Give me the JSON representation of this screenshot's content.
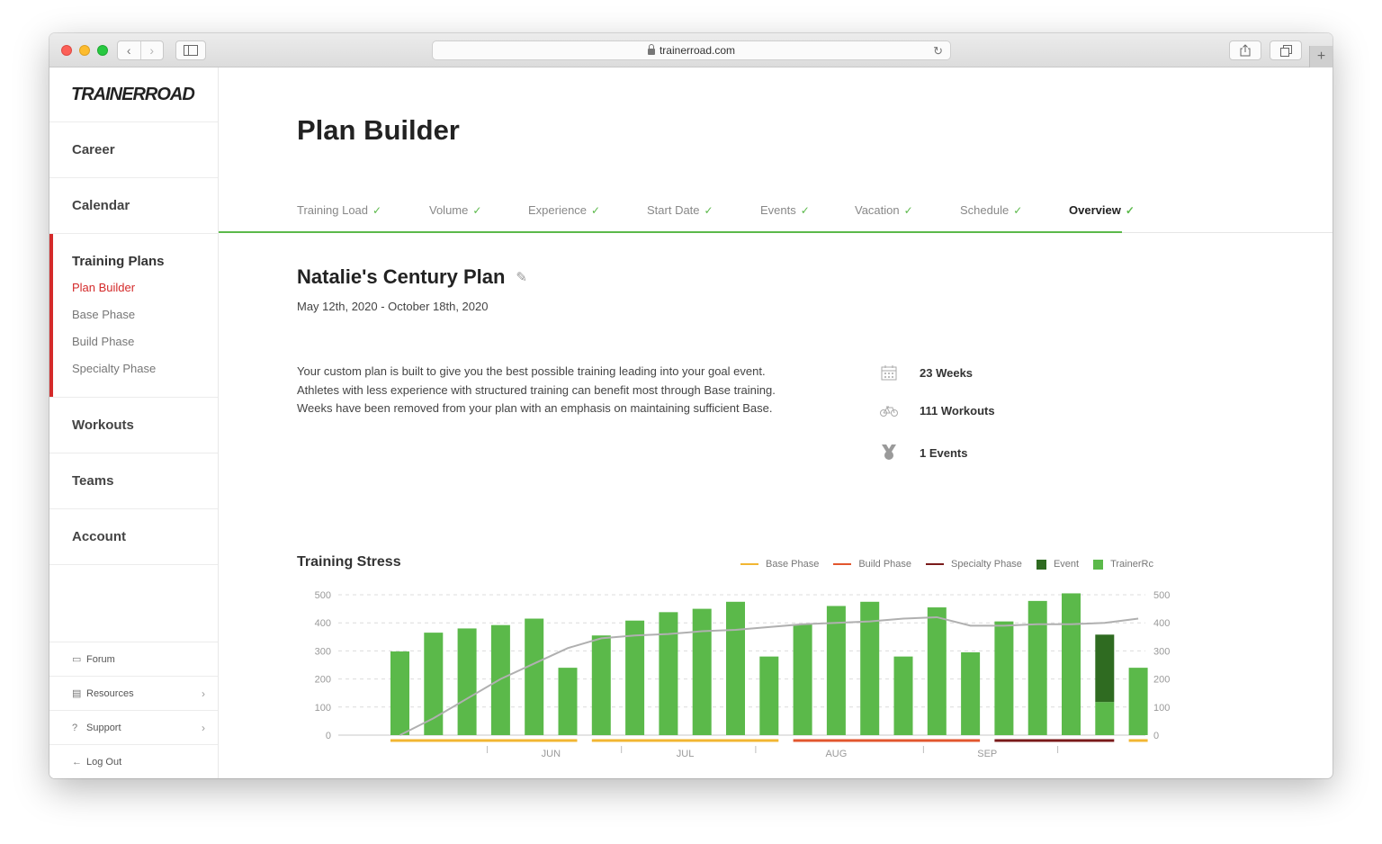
{
  "browser": {
    "url": "trainerroad.com",
    "icons": {
      "back": "chevron-left-icon",
      "forward": "chevron-right-icon",
      "sidebar": "sidebar-icon",
      "share": "share-icon",
      "tabs": "tabs-icon",
      "new_tab": "plus-icon",
      "reload": "reload-icon",
      "lock": "lock-icon"
    }
  },
  "sidebar": {
    "logo": "TRAINERROAD",
    "items": [
      {
        "label": "Career"
      },
      {
        "label": "Calendar"
      }
    ],
    "group": {
      "title": "Training Plans",
      "subitems": [
        {
          "label": "Plan Builder",
          "active": true
        },
        {
          "label": "Base Phase"
        },
        {
          "label": "Build Phase"
        },
        {
          "label": "Specialty Phase"
        }
      ]
    },
    "items2": [
      {
        "label": "Workouts"
      },
      {
        "label": "Teams"
      },
      {
        "label": "Account"
      }
    ],
    "bottom": [
      {
        "label": "Forum",
        "icon": "chat-icon"
      },
      {
        "label": "Resources",
        "icon": "book-icon",
        "chevron": true
      },
      {
        "label": "Support",
        "icon": "help-icon",
        "chevron": true
      },
      {
        "label": "Log Out",
        "icon": "arrow-left-icon"
      }
    ],
    "accent_color": "#d42a2a"
  },
  "page": {
    "title": "Plan Builder",
    "tabs": [
      {
        "label": "Training Load"
      },
      {
        "label": "Volume"
      },
      {
        "label": "Experience"
      },
      {
        "label": "Start Date"
      },
      {
        "label": "Events"
      },
      {
        "label": "Vacation"
      },
      {
        "label": "Schedule"
      },
      {
        "label": "Overview",
        "current": true
      }
    ],
    "check_glyph": "✓",
    "plan_name": "Natalie's Century Plan",
    "plan_dates": "May 12th, 2020 - October 18th, 2020",
    "description": [
      "Your custom plan is built to give you the best possible training leading into your goal event.",
      "Athletes with less experience with structured training can benefit most through Base training.",
      "Weeks have been removed from your plan with an emphasis on maintaining sufficient Base."
    ],
    "stats": [
      {
        "label": "23 Weeks",
        "icon": "calendar-icon"
      },
      {
        "label": "111 Workouts",
        "icon": "bike-icon"
      },
      {
        "label": "1 Events",
        "icon": "medal-icon"
      }
    ]
  },
  "chart_data": {
    "type": "bar",
    "title": "Training Stress",
    "legend": [
      {
        "label": "Base Phase",
        "color": "#f2b632",
        "kind": "line"
      },
      {
        "label": "Build Phase",
        "color": "#e2562e",
        "kind": "line"
      },
      {
        "label": "Specialty Phase",
        "color": "#7a1a1a",
        "kind": "line"
      },
      {
        "label": "Event",
        "color": "#2f6b21",
        "kind": "square"
      },
      {
        "label": "TrainerRc",
        "color": "#5bb94a",
        "kind": "square"
      }
    ],
    "ylim": [
      0,
      500
    ],
    "yticks_left": [
      "500",
      "400",
      "300",
      "200",
      "100",
      "0"
    ],
    "yticks_right": [
      "500",
      "400",
      "300",
      "200",
      "100",
      "0"
    ],
    "month_labels": [
      {
        "label": "JUN",
        "after_bar": 4.5
      },
      {
        "label": "JUL",
        "after_bar": 8.5
      },
      {
        "label": "AUG",
        "after_bar": 13
      },
      {
        "label": "SEP",
        "after_bar": 17.5
      }
    ],
    "month_separators_after_bar": [
      2.6,
      6.6,
      10.6,
      15.6,
      19.6
    ],
    "series": [
      {
        "name": "TrainerRc",
        "values": [
          298,
          365,
          380,
          392,
          415,
          240,
          355,
          408,
          438,
          450,
          475,
          280,
          395,
          460,
          475,
          280,
          455,
          295,
          405,
          478,
          505,
          118,
          240
        ]
      },
      {
        "name": "Event",
        "values": [
          0,
          0,
          0,
          0,
          0,
          0,
          0,
          0,
          0,
          0,
          0,
          0,
          0,
          0,
          0,
          0,
          0,
          0,
          0,
          0,
          0,
          240,
          0
        ]
      }
    ],
    "fitness_line": [
      0,
      60,
      130,
      200,
      255,
      310,
      345,
      355,
      360,
      370,
      375,
      385,
      395,
      400,
      405,
      415,
      420,
      390,
      390,
      395,
      395,
      400,
      415
    ],
    "phases": [
      {
        "label": "Base Phase",
        "start": 0,
        "end": 5,
        "color": "#f2b632"
      },
      {
        "label": "Base Phase",
        "start": 6,
        "end": 11,
        "color": "#f2b632"
      },
      {
        "label": "Build Phase",
        "start": 12,
        "end": 17,
        "color": "#e2562e"
      },
      {
        "label": "Specialty Phase",
        "start": 18,
        "end": 21,
        "color": "#7a1a1a"
      },
      {
        "label": "Base Phase",
        "start": 22,
        "end": 22,
        "color": "#f2b632"
      }
    ],
    "colors": {
      "bar": "#5bb94a",
      "event": "#2f6b21",
      "line": "#b0b0b0",
      "grid": "#dcdcdc",
      "axis": "#9a9a9a"
    }
  }
}
